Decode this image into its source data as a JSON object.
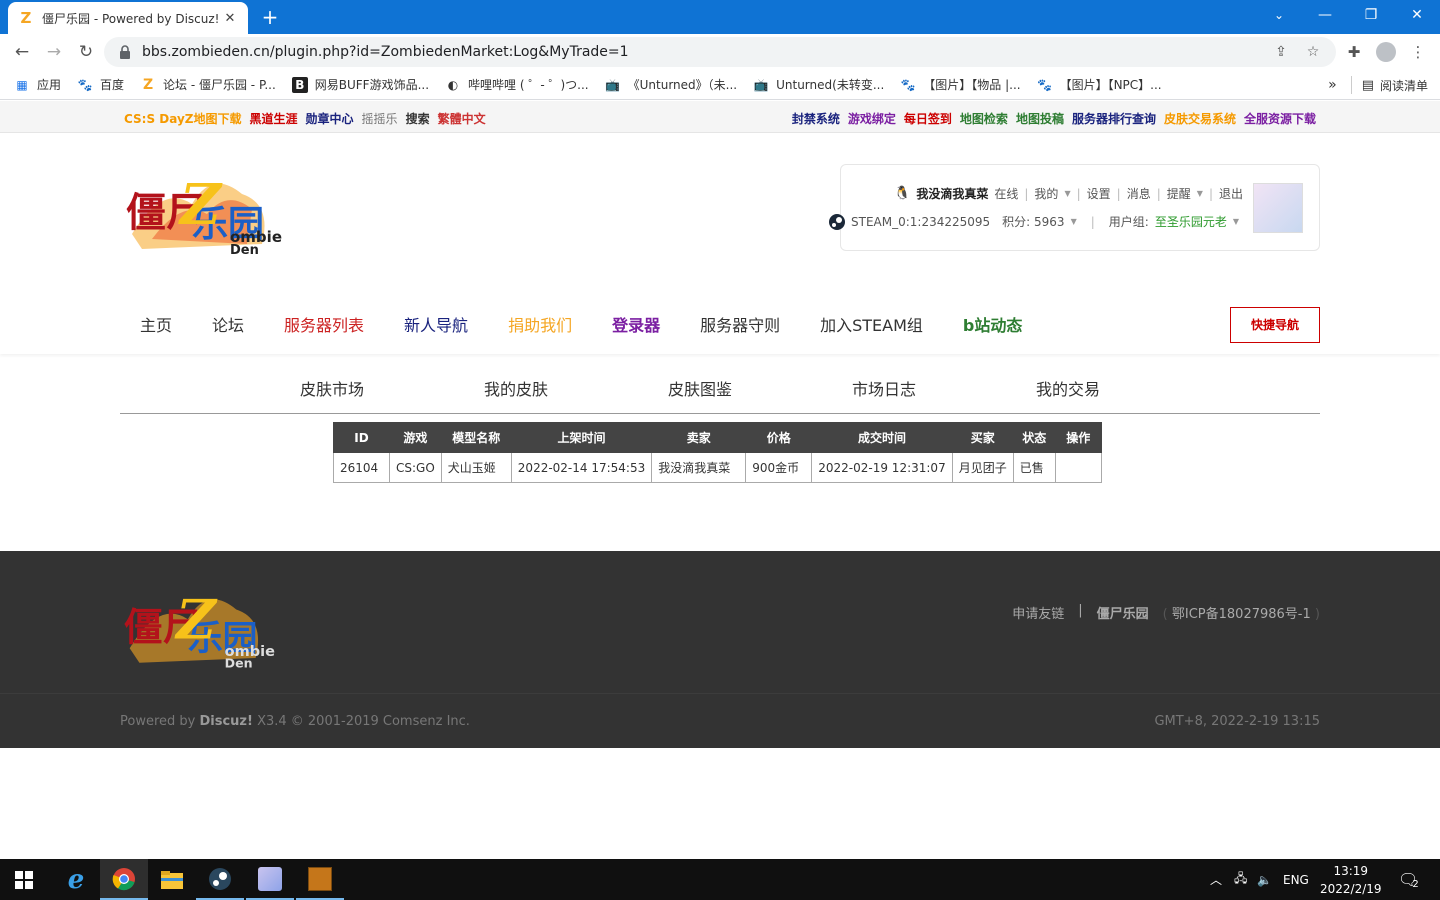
{
  "browser": {
    "tab_title": "僵尸乐园 - Powered by Discuz!",
    "url": "bbs.zombieden.cn/plugin.php?id=ZombiedenMarket:Log&MyTrade=1",
    "bookmarks": [
      {
        "label": "应用",
        "icon": "apps-grid-icon"
      },
      {
        "label": "百度",
        "icon": "baidu-paw-icon"
      },
      {
        "label": "论坛 - 僵尸乐园 - P...",
        "icon": "zombieden-z-icon"
      },
      {
        "label": "网易BUFF游戏饰品...",
        "icon": "buff-icon"
      },
      {
        "label": "哔哩哔哩 ( ゜- ゜)つ...",
        "icon": "globe-icon"
      },
      {
        "label": "《Unturned》（未...",
        "icon": "bilibili-tv-icon"
      },
      {
        "label": "Unturned(未转变...",
        "icon": "bilibili-tv-icon"
      },
      {
        "label": "【图片】【物品 |...",
        "icon": "baidu-paw-icon"
      },
      {
        "label": "【图片】【NPC】...",
        "icon": "baidu-paw-icon"
      }
    ],
    "bookmarks_more": "»",
    "reading_list": "阅读清单"
  },
  "site_topbar": {
    "left": [
      {
        "label": "CS:S DayZ地图下载",
        "color": "#f59a00"
      },
      {
        "label": "黑道生涯",
        "color": "#cc0000"
      },
      {
        "label": "勋章中心",
        "color": "#1a237e"
      },
      {
        "label": "摇摇乐",
        "color": "#777777"
      },
      {
        "label": "搜索",
        "color": "#333333"
      },
      {
        "label": "繁體中文",
        "color": "#cc3333"
      }
    ],
    "right": [
      {
        "label": "封禁系统",
        "color": "#1a237e"
      },
      {
        "label": "游戏绑定",
        "color": "#7b1fa2"
      },
      {
        "label": "每日签到",
        "color": "#cc0000"
      },
      {
        "label": "地图检索",
        "color": "#2e7d32"
      },
      {
        "label": "地图投稿",
        "color": "#2e7d32"
      },
      {
        "label": "服务器排行查询",
        "color": "#1a237e"
      },
      {
        "label": "皮肤交易系统",
        "color": "#f59a00"
      },
      {
        "label": "全服资源下载",
        "color": "#7b1fa2"
      }
    ]
  },
  "user": {
    "name": "我没滴我真菜",
    "status": "在线",
    "mine": "我的",
    "settings": "设置",
    "messages": "消息",
    "reminders": "提醒",
    "logout": "退出",
    "steam_id": "STEAM_0:1:234225095",
    "points": "积分: 5963",
    "group_label": "用户组:",
    "group_value": "至圣乐园元老"
  },
  "main_nav": [
    {
      "label": "主页",
      "color": "#333333",
      "bold": false
    },
    {
      "label": "论坛",
      "color": "#333333",
      "bold": false
    },
    {
      "label": "服务器列表",
      "color": "#cc2222",
      "bold": false
    },
    {
      "label": "新人导航",
      "color": "#1a237e",
      "bold": false
    },
    {
      "label": "捐助我们",
      "color": "#f5a623",
      "bold": false
    },
    {
      "label": "登录器",
      "color": "#7b1fa2",
      "bold": true
    },
    {
      "label": "服务器守则",
      "color": "#333333",
      "bold": false
    },
    {
      "label": "加入STEAM组",
      "color": "#333333",
      "bold": false
    },
    {
      "label": "b站动态",
      "color": "#2e7d32",
      "bold": true
    }
  ],
  "quick_nav": "快捷导航",
  "sub_nav": [
    "皮肤市场",
    "我的皮肤",
    "皮肤图鉴",
    "市场日志",
    "我的交易"
  ],
  "trade_table": {
    "headers": [
      "ID",
      "游戏",
      "模型名称",
      "上架时间",
      "卖家",
      "价格",
      "成交时间",
      "买家",
      "状态",
      "操作"
    ],
    "rows": [
      [
        "26104",
        "CS:GO",
        "犬山玉姬",
        "2022-02-14 17:54:53",
        "我没滴我真菜",
        "900金币",
        "2022-02-19 12:31:07",
        "月见团子",
        "已售",
        ""
      ]
    ]
  },
  "footer": {
    "links": [
      "申请友链",
      "|",
      "僵尸乐园",
      "(",
      "鄂ICP备18027986号-1",
      ")"
    ],
    "powered_prefix": "Powered by ",
    "powered_brand": "Discuz!",
    "powered_suffix": " X3.4 © 2001-2019 Comsenz Inc.",
    "gmt": "GMT+8, 2022-2-19 13:15"
  },
  "logo_text": {
    "cn": "僵尸乐园",
    "en1": "ombie",
    "en2": "Den",
    "z": "Z"
  },
  "taskbar": {
    "lang": "ENG",
    "time": "13:19",
    "date": "2022/2/19",
    "notif_count": "2"
  }
}
